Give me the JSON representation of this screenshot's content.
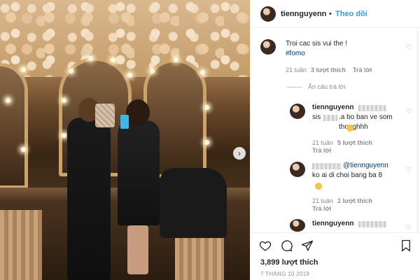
{
  "post": {
    "username": "tiennguyenn",
    "separator": "•",
    "follow_label": "Theo dõi",
    "next_icon": "chevron-right-icon"
  },
  "caption": {
    "text": "Troi cac sis vui the !",
    "hashtag": "#fomo",
    "age": "21 tuần",
    "likes": "3 lượt thích",
    "reply_label": "Trả lời"
  },
  "hide_replies_label": "Ẩn câu trả lời",
  "replies": [
    {
      "username": "tiennguyenn",
      "text_prefix": "sis",
      "text_body": ".a bo ban ve som thoughhh",
      "age": "21 tuần",
      "likes": "5 lượt thích",
      "reply_label": "Trả lời"
    },
    {
      "mention": "@tiennguyenn",
      "text_body": "ko ai di choi bang ba 8",
      "age": "21 tuần",
      "likes": "1 lượt thích",
      "reply_label": "Trả lời"
    },
    {
      "username": "tiennguyenn"
    }
  ],
  "footer": {
    "likes_count": "3,899 lượt thích",
    "date": "7 THÁNG 10 2019"
  },
  "colors": {
    "link_blue": "#3897f0",
    "meta_gray": "#8e8e8e",
    "text": "#262626"
  }
}
